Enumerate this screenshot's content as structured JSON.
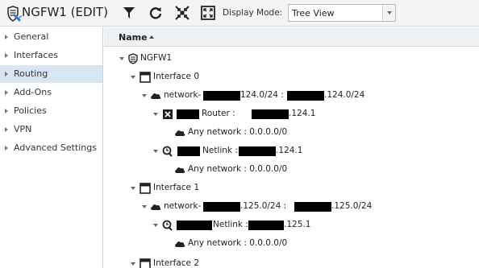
{
  "toolbar": {
    "title": "NGFW1 (EDIT)",
    "display_mode_label": "Display Mode:",
    "display_mode_value": "Tree View",
    "icons": [
      "firewall-app-icon",
      "filter-icon",
      "refresh-icon",
      "collapse-all-icon",
      "expand-all-icon"
    ]
  },
  "sidebar": {
    "items": [
      {
        "label": "General",
        "active": false
      },
      {
        "label": "Interfaces",
        "active": false
      },
      {
        "label": "Routing",
        "active": true
      },
      {
        "label": "Add-Ons",
        "active": false
      },
      {
        "label": "Policies",
        "active": false
      },
      {
        "label": "VPN",
        "active": false
      },
      {
        "label": "Advanced Settings",
        "active": false
      }
    ]
  },
  "main": {
    "column_header": "Name",
    "tree": {
      "root": "NGFW1",
      "iface0": "Interface 0",
      "net0_a": "network-",
      "net0_b": "124.0/24 :",
      "net0_c": ".124.0/24",
      "router0_a": "Router :",
      "router0_b": ".124.1",
      "any0": "Any network : 0.0.0.0/0",
      "netlink0_a": "Netlink :",
      "netlink0_b": ".124.1",
      "any1": "Any network : 0.0.0.0/0",
      "iface1": "Interface 1",
      "net1_a": "network-",
      "net1_b": ".125.0/24 :",
      "net1_c": ".125.0/24",
      "netlink1_a": "Netlink :",
      "netlink1_b": ".125.1",
      "any2": "Any network : 0.0.0.0/0",
      "iface2": "Interface 2"
    }
  }
}
